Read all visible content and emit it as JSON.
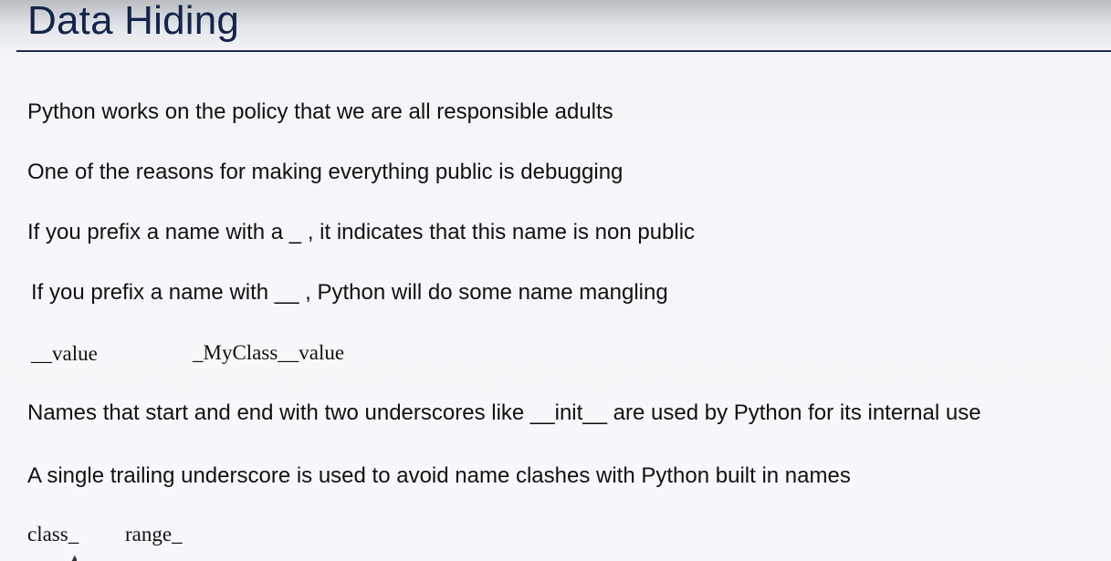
{
  "slide": {
    "title": "Data Hiding",
    "lines": [
      "Python works on the policy that we are all responsible adults",
      "One of the reasons for making everything public is debugging",
      "If you prefix a name with a _ , it indicates that this name is non public",
      "If you prefix a name with __ , Python will do some name mangling",
      "Names that start and end with two underscores like __init__ are used by Python for its internal use",
      "A single trailing underscore is used to avoid name clashes with Python built in names"
    ],
    "mangling_example": {
      "original": "__value",
      "mangled": "_MyClass__value"
    },
    "trailing_examples": [
      "class_",
      "range_"
    ]
  },
  "colors": {
    "title": "#14234a",
    "rule": "#1f2c4c",
    "text": "#111111",
    "background": "#f5f7fa"
  }
}
